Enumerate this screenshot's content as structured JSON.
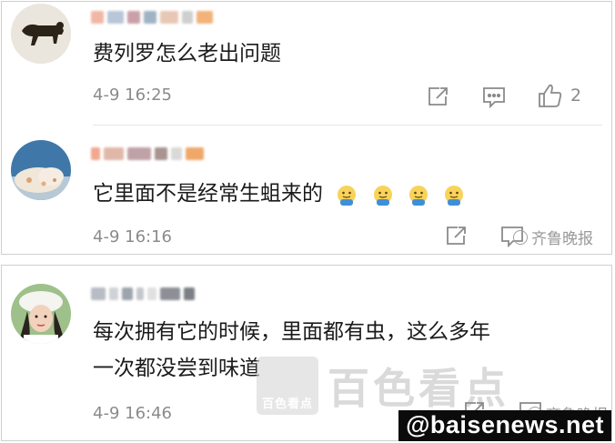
{
  "comments_top": [
    {
      "text": "费列罗怎么老出问题",
      "time": "4-9 16:25",
      "like_count": "2"
    },
    {
      "text": "它里面不是经常生蛆来的",
      "time": "4-9 16:16",
      "emoji_count": 4
    }
  ],
  "comment_bottom": {
    "text_line1": "每次拥有它的时候，里面都有虫，这么多年",
    "text_line2": "一次都没尝到味道",
    "time": "4-9 16:46"
  },
  "watermarks": {
    "small_top": "齐鲁晚报",
    "small_bottom": "齐鲁晚报",
    "big_text": "百色看点",
    "big_box_label": "百色看点",
    "url": "@baisenews.net"
  },
  "icons": {
    "share": "share-icon",
    "comment": "comment-icon",
    "like": "thumb-up-icon"
  },
  "colors": {
    "text": "#1b1b1b",
    "meta": "#8b8b8b",
    "divider": "#e6e6e6"
  }
}
